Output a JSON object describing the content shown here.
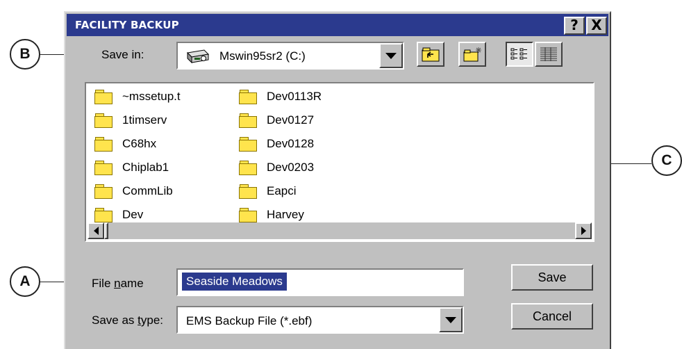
{
  "callouts": {
    "a": "A",
    "b": "B",
    "c": "C"
  },
  "dialog": {
    "title": "FACILITY BACKUP",
    "help_button": "?",
    "close_button": "X"
  },
  "save_in": {
    "label": "Save in:",
    "value": "Mswin95sr2 (C:)"
  },
  "files": {
    "col1": [
      "~mssetup.t",
      "1timserv",
      "C68hx",
      "Chiplab1",
      "CommLib",
      "Dev"
    ],
    "col2": [
      "Dev0113R",
      "Dev0127",
      "Dev0128",
      "Dev0203",
      "Eapci",
      "Harvey"
    ]
  },
  "file_name": {
    "label_pre": "File ",
    "label_accel": "n",
    "label_post": "ame",
    "value": "Seaside Meadows"
  },
  "save_as_type": {
    "label_pre": "Save as ",
    "label_accel": "t",
    "label_post": "ype:",
    "value": "EMS Backup File (*.ebf)"
  },
  "buttons": {
    "save": "Save",
    "cancel": "Cancel"
  },
  "icons": {
    "drive": "hard-drive-icon",
    "up": "up-one-level-icon",
    "new_folder": "new-folder-icon",
    "list_view": "list-view-icon",
    "details_view": "details-view-icon"
  },
  "colors": {
    "titlebar": "#2b3a8e",
    "dialog_bg": "#c0c0c0",
    "selection": "#2b3a8e",
    "folder": "#ffe44d"
  }
}
